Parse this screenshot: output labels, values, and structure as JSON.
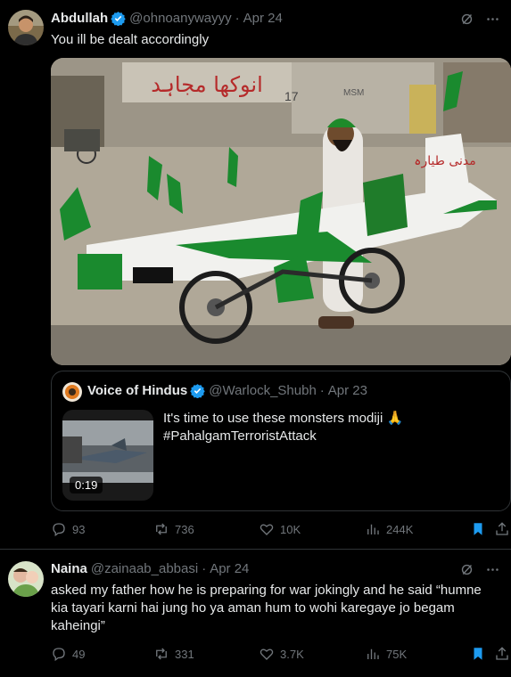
{
  "tweets": [
    {
      "name": "Abdullah",
      "handle": "@ohnoanywayyy",
      "date": "Apr 24",
      "text": "You ill be dealt accordingly",
      "quote": {
        "name": "Voice of Hindus",
        "handle": "@Warlock_Shubh",
        "date": "Apr 23",
        "line1": "It's time to use these monsters modiji 🙏",
        "line2": "#PahalgamTerroristAttack",
        "duration": "0:19"
      },
      "actions": {
        "replies": "93",
        "reposts": "736",
        "likes": "10K",
        "views": "244K"
      }
    },
    {
      "name": "Naina",
      "handle": "@zainaab_abbasi",
      "date": "Apr 24",
      "line1": "asked my father how he is preparing for war jokingly and he said “humne",
      "line2": "kia tayari karni hai jung ho ya aman hum to wohi karegaye jo begam",
      "line3": "kaheingi”",
      "actions": {
        "replies": "49",
        "reposts": "331",
        "likes": "3.7K",
        "views": "75K"
      }
    }
  ],
  "photo_sign": {
    "shop": "انوکھا مجاہد",
    "msm": "MSM",
    "num": "17",
    "wing": "مدنی طیارہ"
  },
  "colors": {
    "accent": "#1d9bf0",
    "muted": "#71767b",
    "green": "#1a8a2e",
    "bookmark": "#1d9bf0"
  },
  "icons": [
    "verified-badge-icon",
    "grok-icon",
    "more-icon",
    "reply-icon",
    "repost-icon",
    "like-icon",
    "views-icon",
    "bookmark-icon",
    "share-icon"
  ]
}
